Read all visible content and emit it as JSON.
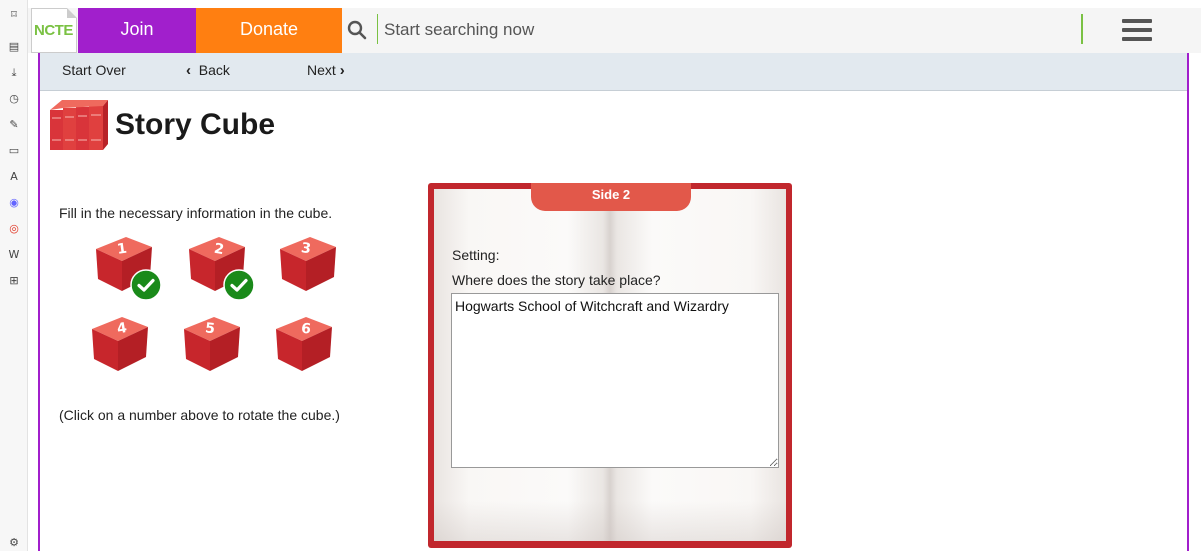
{
  "header": {
    "logo_text": "NCTE",
    "join_label": "Join",
    "donate_label": "Donate",
    "search_placeholder": "Start searching now"
  },
  "subnav": {
    "start_over": "Start Over",
    "back": "Back",
    "next": "Next"
  },
  "page": {
    "title": "Story Cube",
    "instruction": "Fill in the necessary information in the cube.",
    "hint": "(Click on a number above to rotate the cube.)"
  },
  "cubes": [
    {
      "number": "1",
      "completed": true
    },
    {
      "number": "2",
      "completed": true
    },
    {
      "number": "3",
      "completed": false
    },
    {
      "number": "4",
      "completed": false
    },
    {
      "number": "5",
      "completed": false
    },
    {
      "number": "6",
      "completed": false
    }
  ],
  "book": {
    "side_label": "Side 2",
    "field_label": "Setting:",
    "question": "Where does the story take place?",
    "answer": "Hogwarts School of Witchcraft and Wizardry"
  },
  "colors": {
    "join": "#a11fcc",
    "donate": "#ff7f11",
    "accent_green": "#7ac143",
    "book_red": "#c1272d",
    "check_green": "#1a8a1a"
  }
}
